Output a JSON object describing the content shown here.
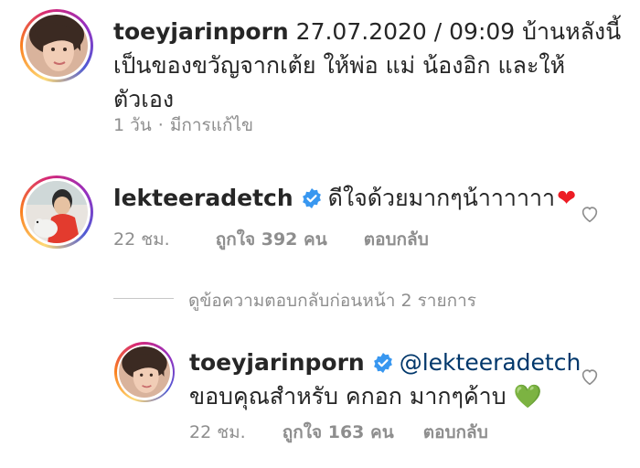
{
  "post": {
    "username": "toeyjarinporn",
    "caption_line1": "27.07.2020 / 09:09 บ้านหลังนี้",
    "caption_line2": "เป็นของขวัญจากเต้ย ให้พ่อ แม่ น้องอิก และให้",
    "caption_line3": "ตัวเอง",
    "time": "1 วัน",
    "separator": "·",
    "edited": "มีการแก้ไข"
  },
  "comment1": {
    "username": "lekteeradetch",
    "text": "ดีใจด้วยมากๆน้าาาาาา",
    "emoji": "❤",
    "time": "22 ชม.",
    "likes_prefix": "ถูกใจ",
    "likes_count": "392",
    "likes_suffix": "คน",
    "reply_label": "ตอบกลับ"
  },
  "view_replies": "ดูข้อความตอบกลับก่อนหน้า 2 รายการ",
  "reply1": {
    "username": "toeyjarinporn",
    "mention": "@lekteeradetch",
    "text": "ขอบคุณสำหรับ คกอก มากๆค้าบ",
    "emoji": "💚",
    "time": "22 ชม.",
    "likes_prefix": "ถูกใจ",
    "likes_count": "163",
    "likes_suffix": "คน",
    "reply_label": "ตอบกลับ"
  },
  "colors": {
    "text": "#262626",
    "secondary": "#8e8e8e",
    "verified": "#3897f0",
    "mention": "#00376b",
    "red_heart": "#ed1c24",
    "green_heart": "#7ac943"
  }
}
